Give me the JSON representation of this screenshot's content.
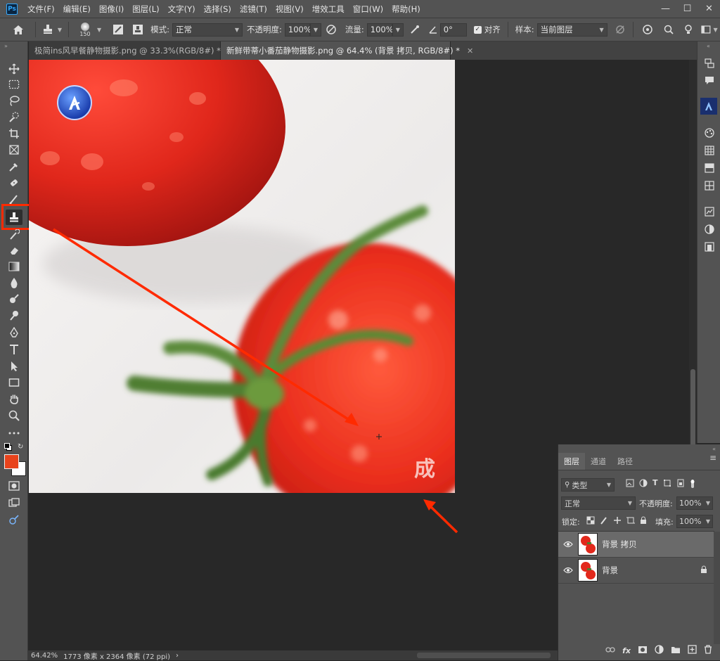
{
  "app": {
    "logo_text": "Ps"
  },
  "menu": [
    "文件(F)",
    "编辑(E)",
    "图像(I)",
    "图层(L)",
    "文字(Y)",
    "选择(S)",
    "滤镜(T)",
    "视图(V)",
    "增效工具",
    "窗口(W)",
    "帮助(H)"
  ],
  "window_controls": {
    "minimize": "—",
    "maximize": "☐",
    "close": "✕"
  },
  "options": {
    "brush_size": "150",
    "mode_label": "模式:",
    "mode_value": "正常",
    "opacity_label": "不透明度:",
    "opacity_value": "100%",
    "flow_label": "流量:",
    "flow_value": "100%",
    "angle_value": "0°",
    "aligned_label": "对齐",
    "sample_label": "样本:",
    "sample_value": "当前图层"
  },
  "tabs": [
    {
      "title": "极简ins风早餐静物摄影.png @ 33.3%(RGB/8#) *",
      "active": false
    },
    {
      "title": "新鲜带蒂小番茄静物摄影.png @ 64.4% (背景 拷贝, RGB/8#) *",
      "active": true
    }
  ],
  "canvas": {
    "watermark_text": "成"
  },
  "status": {
    "zoom": "64.42%",
    "doc_info": "1773 像素 x 2364 像素 (72 ppi)",
    "nav_arrow": "›"
  },
  "layers_panel": {
    "tabs": [
      "图层",
      "通道",
      "路径"
    ],
    "filter_type": "类型",
    "blend_mode": "正常",
    "opacity_label": "不透明度:",
    "opacity_value": "100%",
    "lock_label": "锁定:",
    "fill_label": "填充:",
    "fill_value": "100%",
    "layers": [
      {
        "name": "背景 拷贝",
        "selected": true,
        "locked": false
      },
      {
        "name": "背景",
        "selected": false,
        "locked": true
      }
    ],
    "footer_icons": [
      "link-icon",
      "fx-icon",
      "mask-icon",
      "adjustment-icon",
      "group-icon",
      "new-layer-icon",
      "delete-icon"
    ],
    "fx_text": "fx"
  },
  "colors": {
    "foreground": "#e8431c",
    "background": "#ffffff",
    "highlight": "#ff2a00",
    "ui_dark": "#535353"
  }
}
